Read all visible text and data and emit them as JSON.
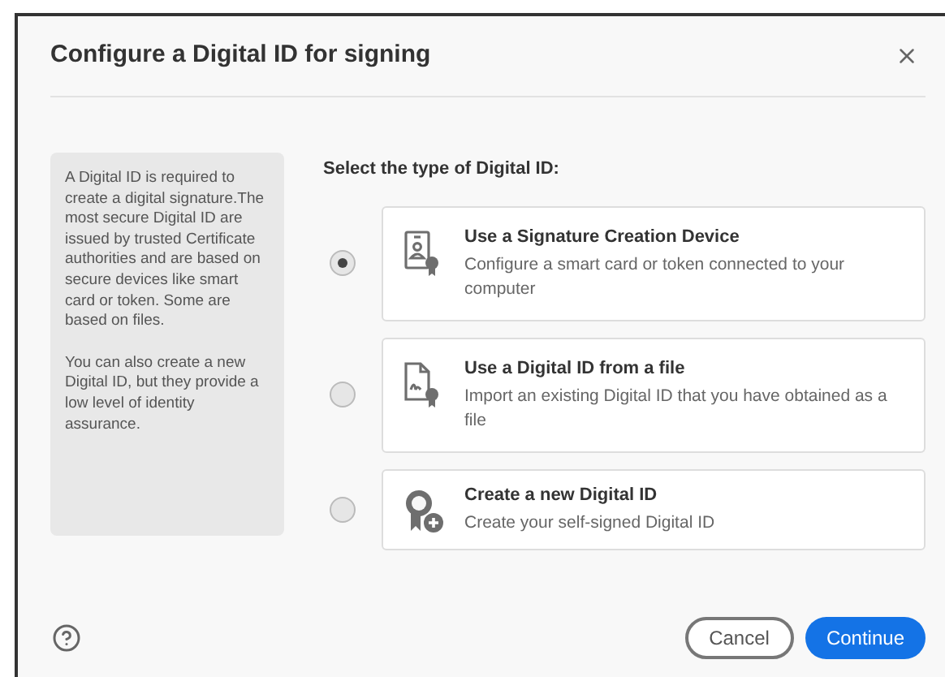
{
  "dialog": {
    "title": "Configure a Digital ID for signing"
  },
  "info_panel": {
    "paragraphs": [
      "A Digital ID is required to create a digital signature.The most secure Digital ID are issued by trusted Certificate authorities and are based on secure devices like smart card or token. Some are based on files.",
      "You can also create a new Digital ID, but they provide a low level of identity assurance."
    ]
  },
  "options_heading": "Select the type of Digital ID:",
  "options": [
    {
      "kind": "device",
      "title": "Use a Signature Creation Device",
      "description": "Configure a smart card or token connected to your computer",
      "selected": true
    },
    {
      "kind": "file",
      "title": "Use a Digital ID from a file",
      "description": "Import an existing Digital ID that you have obtained as a file",
      "selected": false
    },
    {
      "kind": "new",
      "title": "Create a new Digital ID",
      "description": "Create your self-signed Digital ID",
      "selected": false
    }
  ],
  "buttons": {
    "cancel": "Cancel",
    "continue": "Continue"
  }
}
